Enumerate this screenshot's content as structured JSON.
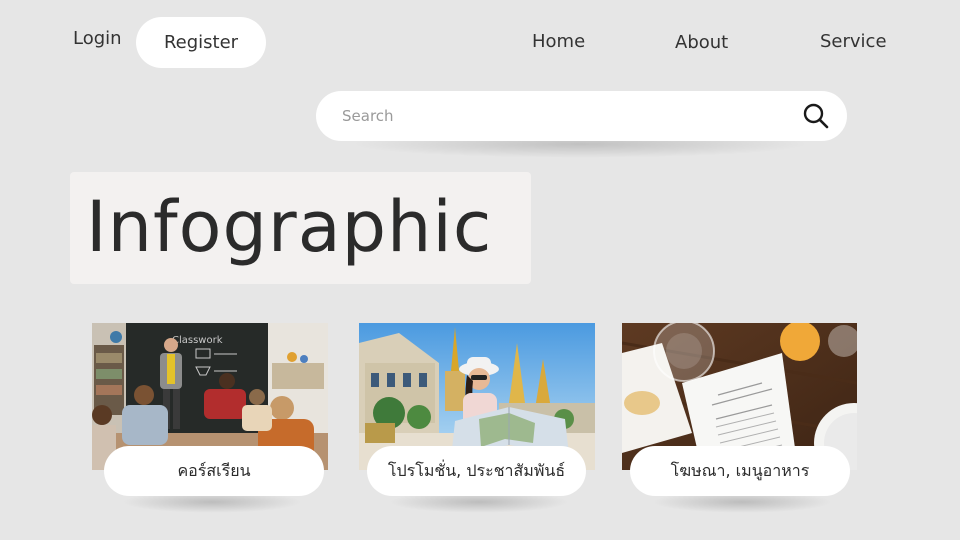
{
  "nav": {
    "login_label": "Login",
    "register_label": "Register",
    "links": [
      {
        "label": "Home"
      },
      {
        "label": "About"
      },
      {
        "label": "Service"
      }
    ]
  },
  "search": {
    "placeholder": "Search",
    "value": ""
  },
  "hero": {
    "title": "Infographic"
  },
  "cards": [
    {
      "label": "คอร์สเรียน",
      "image": "classroom-photo"
    },
    {
      "label": "โปรโมชั่น, ประชาสัมพันธ์",
      "image": "tourist-with-map-photo"
    },
    {
      "label": "โฆษณา, เมนูอาหาร",
      "image": "restaurant-menu-table-photo"
    }
  ],
  "colors": {
    "background": "#e6e6e6",
    "surface": "#ffffff",
    "title_box": "#f3f1f0",
    "text": "#2d2d2d",
    "placeholder": "#9a9a9a"
  },
  "icons": {
    "search": "search-icon"
  }
}
